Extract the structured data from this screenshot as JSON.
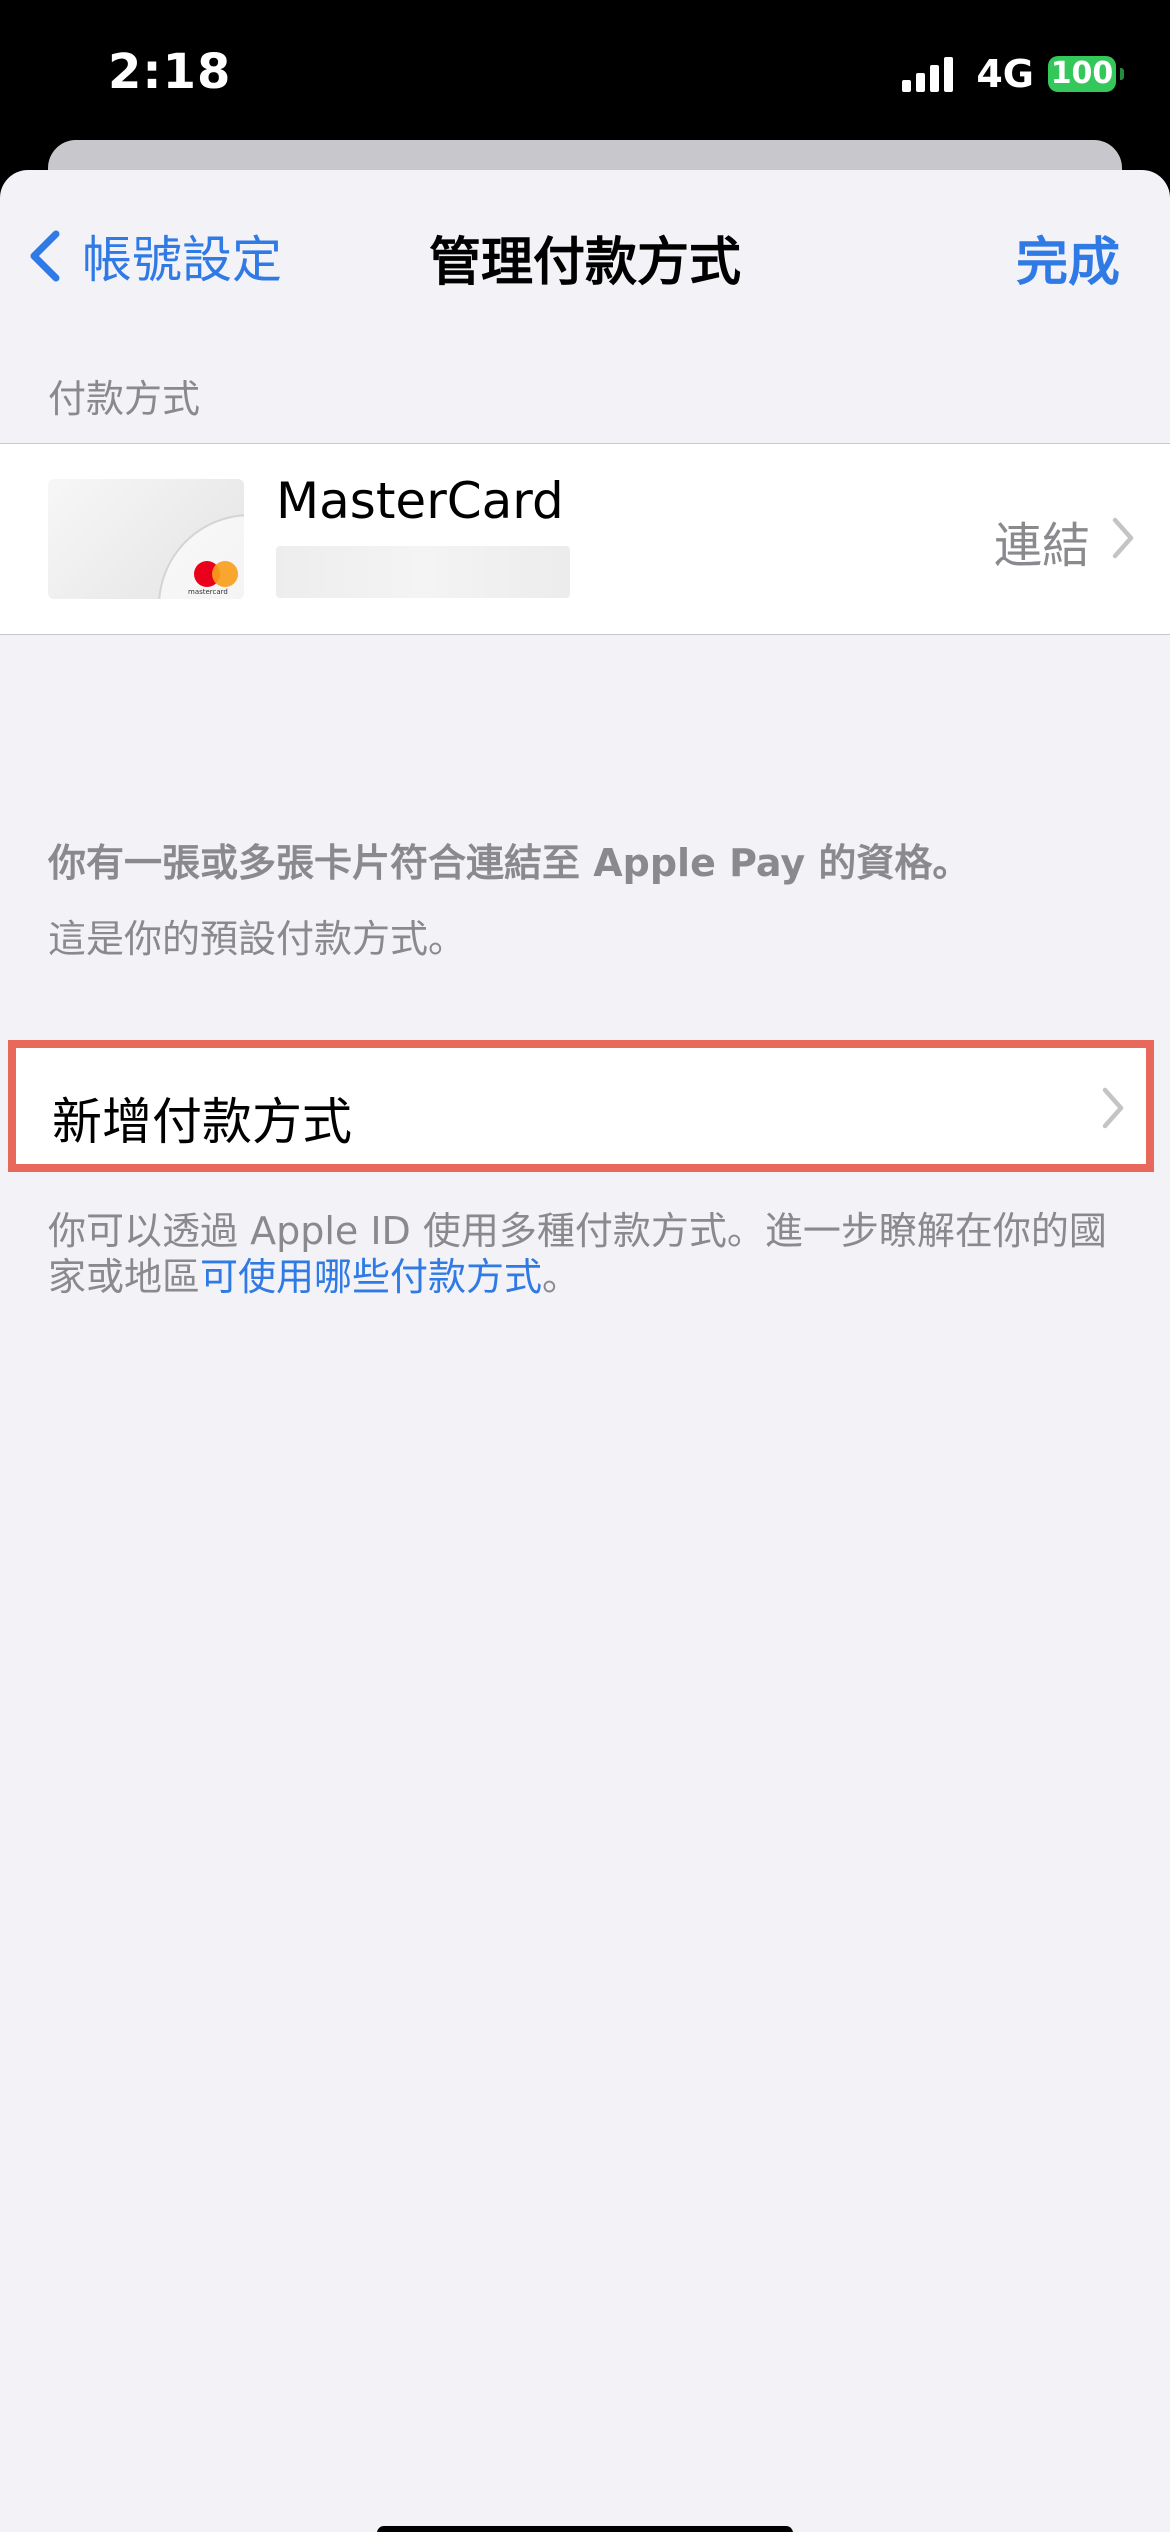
{
  "status_bar": {
    "time": "2:18",
    "network": "4G",
    "battery": "100"
  },
  "nav": {
    "back_label": "帳號設定",
    "title": "管理付款方式",
    "done_label": "完成"
  },
  "section": {
    "header": "付款方式"
  },
  "card": {
    "name": "MasterCard",
    "brand_text": "mastercard",
    "action": "連結"
  },
  "notes": {
    "apple_pay_eligible": "你有一張或多張卡片符合連結至 Apple Pay 的資格。",
    "default_method": "這是你的預設付款方式。"
  },
  "add_method": {
    "label": "新增付款方式"
  },
  "footer": {
    "text_before": "你可以透過 Apple ID 使用多種付款方式。進一步瞭解在你的國家或地區",
    "link": "可使用哪些付款方式",
    "text_after": "。"
  },
  "colors": {
    "accent": "#2f7ae5",
    "highlight_border": "#e8695c",
    "battery": "#34c759"
  }
}
